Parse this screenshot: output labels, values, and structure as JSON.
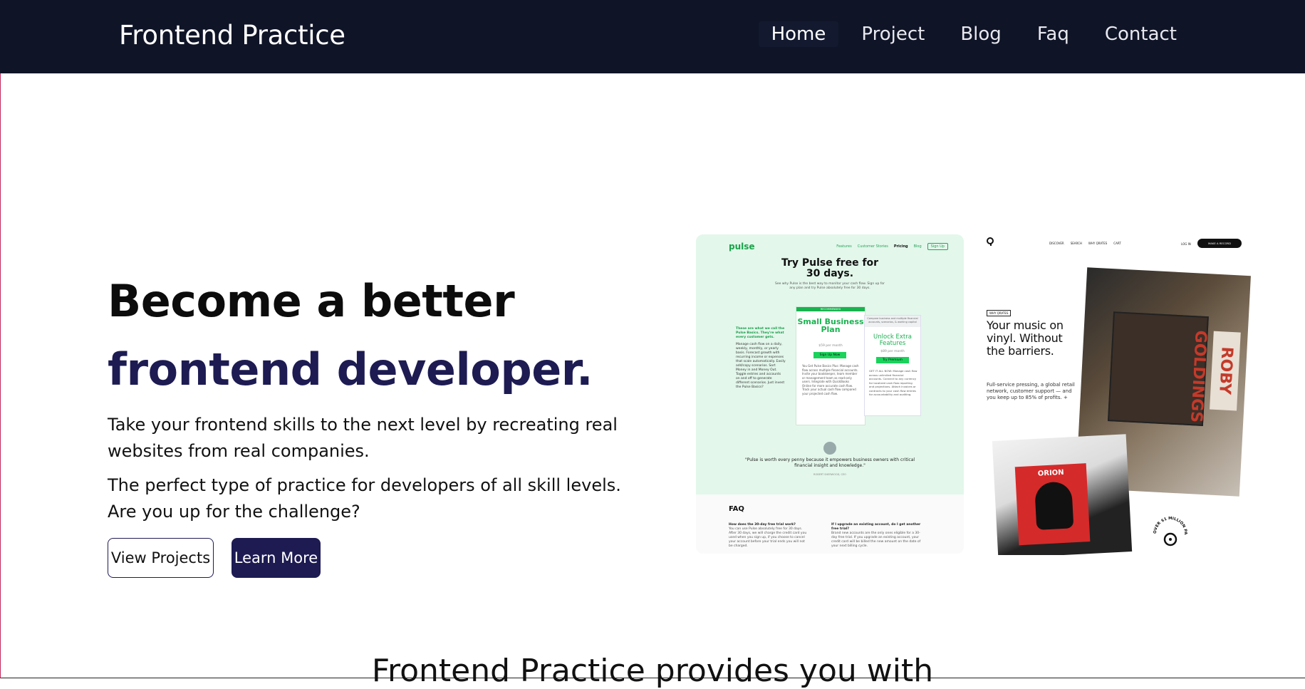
{
  "nav": {
    "brand": "Frontend Practice",
    "links": [
      "Home",
      "Project",
      "Blog",
      "Faq",
      "Contact"
    ]
  },
  "hero": {
    "title_line1": "Become a better",
    "title_line2": "frontend developer.",
    "paragraph1": "Take your frontend skills to the next level by recreating real websites from real companies.",
    "paragraph2": "The perfect type of practice for developers of all skill levels. Are you up for the challenge?",
    "btn_view": "View Projects",
    "btn_learn": "Learn More"
  },
  "section_heading": "Frontend Practice provides you with",
  "pulse": {
    "logo": "pulse",
    "nav": [
      "Features",
      "Customer Stories",
      "Pricing",
      "Blog"
    ],
    "nav_signup": "Sign Up",
    "title": "Try Pulse free for 30 days.",
    "subtitle": "See why Pulse is the best way to monitor your cash flow. Sign up for any plan and try Pulse absolutely free for 30 days.",
    "left_heading": "These are what we call the Pulse Basics. They're what every customer gets.",
    "left_text": "Manage cash flow on a daily, weekly, monthly, or yearly basis. Forecast growth with recurring income or expenses that scale automatically. Easily add/copy scenarios. Sort Money in and Money Out. Toggle entries and accounts on and off to generate different scenarios. Just invest the Pulse Basics?",
    "recommended": "RECOMMENDED",
    "plan_name": "Small Business Plan",
    "plan_price": "$59 per month",
    "plan_btn": "Sign Up Now",
    "plan_lines": "You Get Pulse Basics Plus: Manage cash flow across multiple financial accounts. Invite your bookkeeper, team member or management team as read-only users. Integrate with QuickBooks Online for more accurate cash flow. Track your actual cash flow compared your projected cash flow.",
    "extra_header": "Compare business and multiple financial accounts, scenarios, & working capital",
    "extra_name": "Unlock Extra Features",
    "extra_price": "$89 per month",
    "extra_btn": "Try Premium",
    "extra_lines": "GET IT ALL NOW: Manage cash flow across unlimited financial accounts. Connect to any currency for localized cash flow reporting and projections. Attach invoices or contracts to your cash flow entries for accountability and auditing.",
    "quote": "\"Pulse is worth every penny because it empowers business owners with critical financial insight and knowledge.\"",
    "quote_sub": "ROBERT SHERWOOD, CEO",
    "faq_title": "FAQ",
    "faq_q1": "How does the 30-day free trial work?",
    "faq_a1": "You can use Pulse absolutely free for 30 days. After 30 days, we will charge the credit card you used when you sign up, if you choose to cancel your account before your trial ends you will not be charged.",
    "faq_q2": "If I upgrade an existing account, do I get another free trial?",
    "faq_a2": "Brand new accounts are the only ones eligible for a 30-day free trial. If you upgrade an existing account, your credit card will be billed the new amount on the date of your next billing cycle."
  },
  "vinyl": {
    "nav": [
      "DISCOVER",
      "SEARCH",
      "WHY QRATES",
      "CART"
    ],
    "login": "LOG IN",
    "cta": "MAKE A RECORD",
    "badge": "WHY QRATES",
    "title": "Your music on vinyl. Without the barriers.",
    "body": "Full-service pressing, a global retail network, customer support — and you keep up to 85% of profits. +",
    "sleeve_label": "ROBY GOLDINGS",
    "record_label": "ORION",
    "seal": "OVER $1 MILLION PAID TO ARTISTS"
  }
}
